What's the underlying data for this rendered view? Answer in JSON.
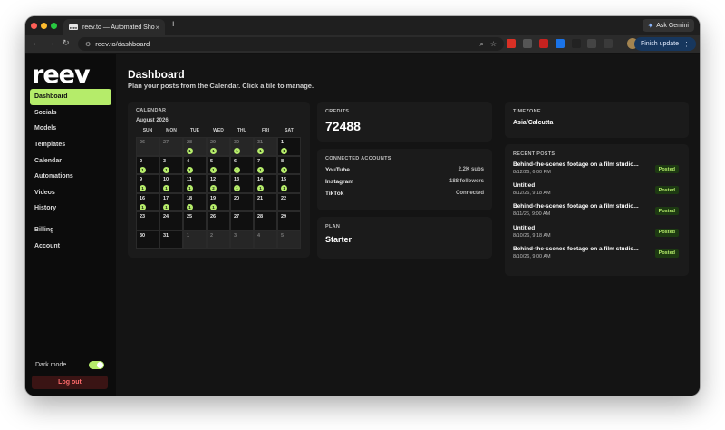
{
  "browser": {
    "tab_title": "reev.to — Automated Shorts",
    "favicon_text": "reev",
    "tab_close": "×",
    "new_tab": "+",
    "ask_gemini": "Ask Gemini",
    "url": "reev.to/dashboard",
    "finish_update": "Finish update",
    "back": "←",
    "forward": "→",
    "reload": "↻"
  },
  "sidebar": {
    "logo": "reev",
    "items": [
      {
        "label": "Dashboard",
        "active": true
      },
      {
        "label": "Socials"
      },
      {
        "label": "Models"
      },
      {
        "label": "Templates"
      },
      {
        "label": "Calendar"
      },
      {
        "label": "Automations"
      },
      {
        "label": "Videos"
      },
      {
        "label": "History"
      }
    ],
    "secondary": [
      {
        "label": "Billing"
      },
      {
        "label": "Account"
      }
    ],
    "dark_mode_label": "Dark mode",
    "dark_mode_on": true,
    "logout": "Log out"
  },
  "header": {
    "title": "Dashboard",
    "subtitle": "Plan your posts from the Calendar. Click a tile to manage."
  },
  "calendar": {
    "label": "Calendar",
    "month": "August 2026",
    "weekdays": [
      "SUN",
      "MON",
      "TUE",
      "WED",
      "THU",
      "FRI",
      "SAT"
    ],
    "days": [
      {
        "d": "26",
        "muted": true
      },
      {
        "d": "27",
        "muted": true
      },
      {
        "d": "28",
        "muted": true,
        "count": "1"
      },
      {
        "d": "29",
        "muted": true,
        "count": "1"
      },
      {
        "d": "30",
        "muted": true,
        "count": "1"
      },
      {
        "d": "31",
        "muted": true,
        "count": "1"
      },
      {
        "d": "1",
        "count": "1"
      },
      {
        "d": "2",
        "count": "1"
      },
      {
        "d": "3",
        "count": "1"
      },
      {
        "d": "4",
        "count": "1"
      },
      {
        "d": "5",
        "count": "1"
      },
      {
        "d": "6",
        "count": "1"
      },
      {
        "d": "7",
        "count": "1"
      },
      {
        "d": "8",
        "count": "1"
      },
      {
        "d": "9",
        "count": "1"
      },
      {
        "d": "10",
        "count": "1"
      },
      {
        "d": "11",
        "count": "1"
      },
      {
        "d": "12",
        "count": "2"
      },
      {
        "d": "13",
        "count": "1"
      },
      {
        "d": "14",
        "count": "1"
      },
      {
        "d": "15",
        "count": "1"
      },
      {
        "d": "16",
        "count": "1"
      },
      {
        "d": "17",
        "count": "1"
      },
      {
        "d": "18",
        "count": "1"
      },
      {
        "d": "19",
        "count": "1"
      },
      {
        "d": "20"
      },
      {
        "d": "21"
      },
      {
        "d": "22"
      },
      {
        "d": "23"
      },
      {
        "d": "24"
      },
      {
        "d": "25"
      },
      {
        "d": "26"
      },
      {
        "d": "27"
      },
      {
        "d": "28"
      },
      {
        "d": "29"
      },
      {
        "d": "30"
      },
      {
        "d": "31"
      },
      {
        "d": "1",
        "muted": true
      },
      {
        "d": "2",
        "muted": true
      },
      {
        "d": "3",
        "muted": true
      },
      {
        "d": "4",
        "muted": true
      },
      {
        "d": "5",
        "muted": true
      }
    ]
  },
  "credits": {
    "label": "Credits",
    "value": "72488"
  },
  "accounts": {
    "label": "Connected accounts",
    "rows": [
      {
        "name": "YouTube",
        "value": "2.2K subs"
      },
      {
        "name": "Instagram",
        "value": "188 followers"
      },
      {
        "name": "TikTok",
        "value": "Connected"
      }
    ]
  },
  "plan": {
    "label": "Plan",
    "value": "Starter"
  },
  "timezone": {
    "label": "Timezone",
    "value": "Asia/Calcutta"
  },
  "recent_posts": {
    "label": "Recent posts",
    "items": [
      {
        "title": "Behind-the-scenes footage on a film studio...",
        "time": "8/12/26, 6:00 PM",
        "status": "Posted"
      },
      {
        "title": "Untitled",
        "time": "8/12/26, 9:18 AM",
        "status": "Posted"
      },
      {
        "title": "Behind-the-scenes footage on a film studio...",
        "time": "8/11/26, 9:00 AM",
        "status": "Posted"
      },
      {
        "title": "Untitled",
        "time": "8/10/26, 9:18 AM",
        "status": "Posted"
      },
      {
        "title": "Behind-the-scenes footage on a film studio...",
        "time": "8/10/26, 9:00 AM",
        "status": "Posted"
      }
    ]
  },
  "colors": {
    "accent": "#b5ec6a",
    "background": "#141414",
    "card": "#1b1b1b",
    "danger": "#ff6b6b"
  }
}
